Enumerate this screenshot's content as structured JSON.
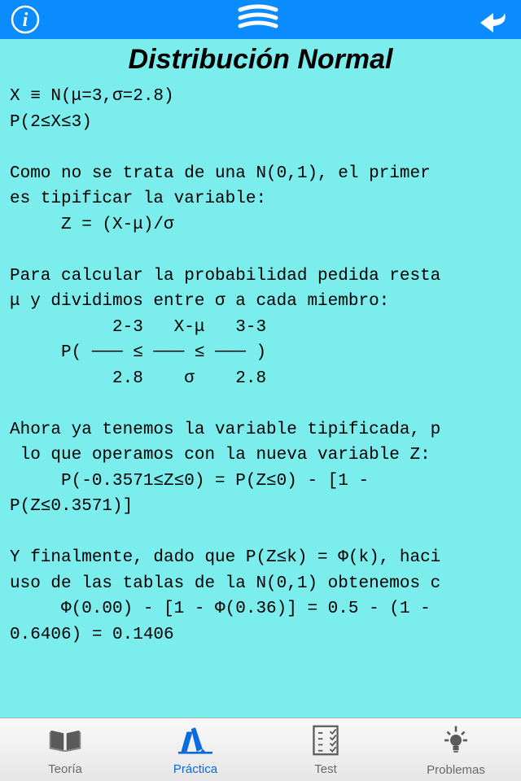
{
  "title": "Distribución Normal",
  "body": "X ≡ N(μ=3,σ=2.8)\nP(2≤X≤3)\n\nComo no se trata de una N(0,1), el primer\nes tipificar la variable:\n     Z = (X-μ)/σ\n\nPara calcular la probabilidad pedida resta\nμ y dividimos entre σ a cada miembro:\n          2-3   X-μ   3-3\n     P( ─── ≤ ─── ≤ ─── )\n          2.8    σ    2.8\n\nAhora ya tenemos la variable tipificada, p\n lo que operamos con la nueva variable Z:\n     P(-0.3571≤Z≤0) = P(Z≤0) - [1 -\nP(Z≤0.3571)]\n\nY finalmente, dado que P(Z≤k) = Φ(k), haci\nuso de las tablas de la N(0,1) obtenemos c\n     Φ(0.00) - [1 - Φ(0.36)] = 0.5 - (1 -\n0.6406) = 0.1406",
  "tabs": {
    "teoria": "Teoría",
    "practica": "Práctica",
    "test": "Test",
    "problemas": "Problemas"
  }
}
